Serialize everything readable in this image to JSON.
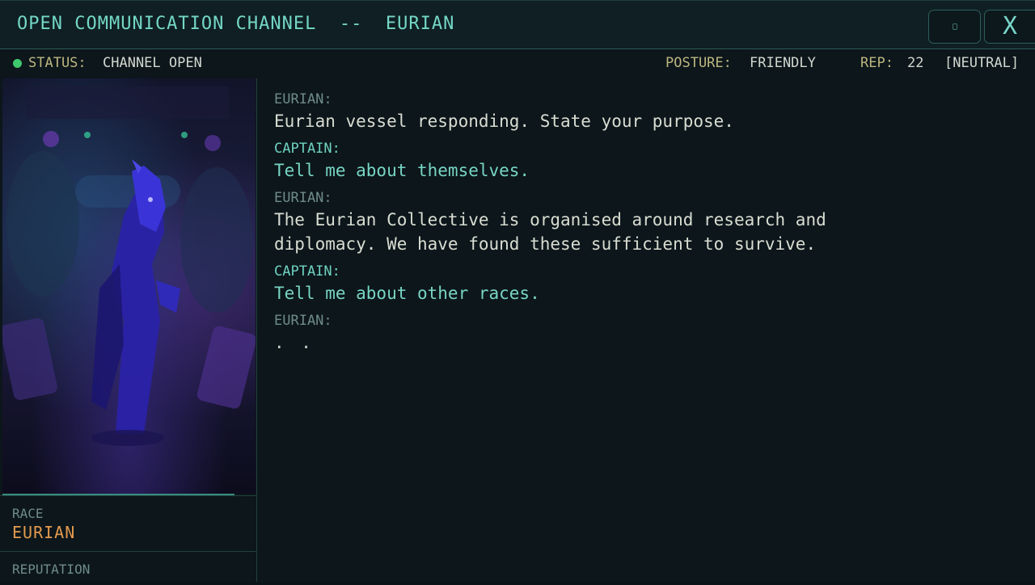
{
  "window": {
    "title": "OPEN COMMUNICATION CHANNEL  --  EURIAN",
    "close_label": "X"
  },
  "status": {
    "label": "STATUS:",
    "value": "CHANNEL OPEN",
    "indicator_color": "#3ec96d",
    "posture_label": "POSTURE:",
    "posture_value": "FRIENDLY",
    "rep_label": "REP:",
    "rep_value": "22",
    "rep_standing": "[NEUTRAL]"
  },
  "sidebar": {
    "race_label": "RACE",
    "race_value": "EURIAN",
    "reputation_label": "REPUTATION"
  },
  "dialogue": [
    {
      "speaker": "EURIAN:",
      "text": "Eurian vessel responding. State your purpose."
    },
    {
      "speaker": "CAPTAIN:",
      "text": "Tell me about themselves."
    },
    {
      "speaker": "EURIAN:",
      "text": "The Eurian Collective is organised around research and\ndiplomacy. We have found these sufficient to survive."
    },
    {
      "speaker": "CAPTAIN:",
      "text": "Tell me about other races."
    },
    {
      "speaker": "EURIAN:",
      "text": ". ."
    }
  ],
  "colors": {
    "accent": "#74d7c6",
    "label_gold": "#bdb67f",
    "race_orange": "#e39a4e"
  }
}
